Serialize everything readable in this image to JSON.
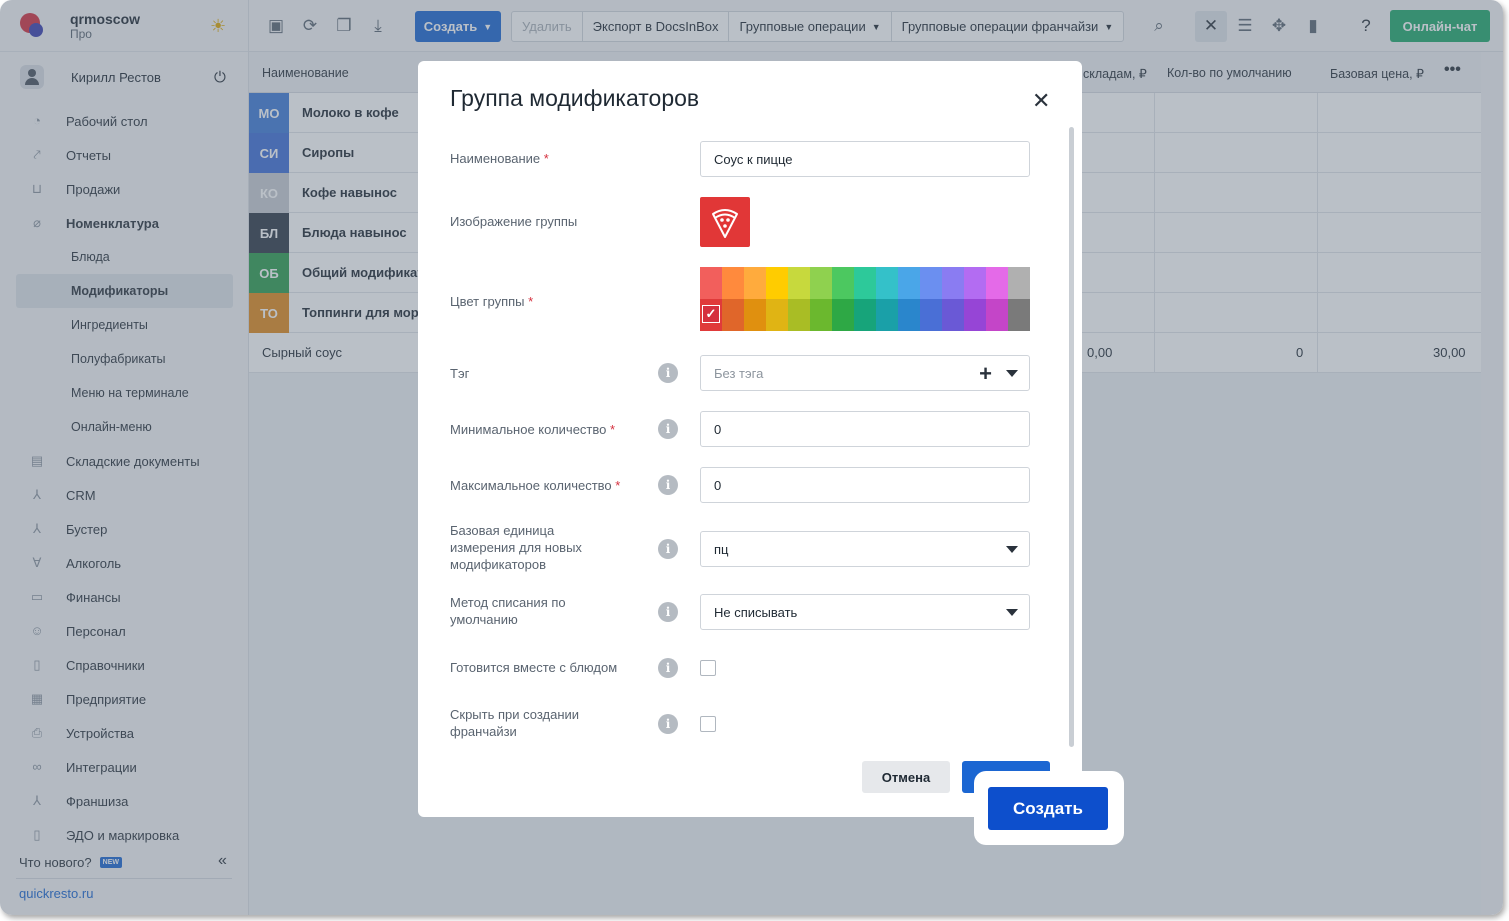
{
  "brand": {
    "name": "qrmoscow",
    "plan": "Про"
  },
  "user": {
    "name": "Кирилл Рестов"
  },
  "nav": [
    {
      "label": "Рабочий стол",
      "icon": "dashboard-icon",
      "glyph": "◔"
    },
    {
      "label": "Отчеты",
      "icon": "chart-icon",
      "glyph": "⤤"
    },
    {
      "label": "Продажи",
      "icon": "basket-icon",
      "glyph": "⊔"
    },
    {
      "label": "Номенклатура",
      "icon": "tag-icon",
      "glyph": "⌀"
    }
  ],
  "nav_sub": [
    "Блюда",
    "Модификаторы",
    "Ингредиенты",
    "Полуфабрикаты",
    "Меню на терминале",
    "Онлайн-меню"
  ],
  "nav_more": [
    {
      "label": "Складские документы",
      "icon": "warehouse-icon",
      "glyph": "▤"
    },
    {
      "label": "CRM",
      "icon": "crm-icon",
      "glyph": "⅄"
    },
    {
      "label": "Бустер",
      "icon": "booster-icon",
      "glyph": "⅄"
    },
    {
      "label": "Алкоголь",
      "icon": "glass-icon",
      "glyph": "∀"
    },
    {
      "label": "Финансы",
      "icon": "wallet-icon",
      "glyph": "▭"
    },
    {
      "label": "Персонал",
      "icon": "people-icon",
      "glyph": "☺"
    },
    {
      "label": "Справочники",
      "icon": "book-icon",
      "glyph": "▯"
    },
    {
      "label": "Предприятие",
      "icon": "building-icon",
      "glyph": "▦"
    },
    {
      "label": "Устройства",
      "icon": "printer-icon",
      "glyph": "⎙"
    },
    {
      "label": "Интеграции",
      "icon": "link-icon",
      "glyph": "∞"
    },
    {
      "label": "Франшиза",
      "icon": "franchise-icon",
      "glyph": "⅄"
    },
    {
      "label": "ЭДО и маркировка",
      "icon": "doc-icon",
      "glyph": "▯"
    }
  ],
  "whats_new": {
    "label": "Что нового?",
    "badge": "NEW"
  },
  "site": "quickresto.ru",
  "toolbar": {
    "create": "Создать",
    "delete": "Удалить",
    "export": "Экспорт в DocsInBox",
    "group_ops": "Групповые операции",
    "group_ops_fr": "Групповые операции франчайзи",
    "chat": "Онлайн-чат"
  },
  "table": {
    "headers": [
      "Наименование",
      "складам, ₽",
      "Кол-во по умолчанию",
      "Базовая цена, ₽"
    ],
    "rows": [
      {
        "abbr": "МО",
        "name": "Молоко в кофе",
        "color": "#3f7bd8"
      },
      {
        "abbr": "СИ",
        "name": "Сиропы",
        "color": "#3f6ed8"
      },
      {
        "abbr": "КО",
        "name": "Кофе навынос",
        "color": "#c8ccd2"
      },
      {
        "abbr": "БЛ",
        "name": "Блюда навынос",
        "color": "#2f3a47"
      },
      {
        "abbr": "ОБ",
        "name": "Общий модификат",
        "color": "#2e9e4e"
      },
      {
        "abbr": "ТО",
        "name": "Топпинги для моро",
        "color": "#e28a1c"
      }
    ],
    "plain_row": {
      "name": "Сырный соус",
      "v1": "0,00",
      "v2": "0",
      "v3": "30,00"
    }
  },
  "modal": {
    "title": "Группа модификаторов",
    "fields": {
      "name_label": "Наименование",
      "name_value": "Соус к пицце",
      "image_label": "Изображение группы",
      "color_label": "Цвет группы",
      "tag_label": "Тэг",
      "tag_placeholder": "Без тэга",
      "min_label": "Минимальное количество",
      "min_value": "0",
      "max_label": "Максимальное количество",
      "max_value": "0",
      "unit_label": "Базовая единица измерения для новых модификаторов",
      "unit_value": "пц",
      "method_label": "Метод списания по умолчанию",
      "method_value": "Не списывать",
      "cooked_label": "Готовится вместе с блюдом",
      "hide_label": "Скрыть при создании франчайзи"
    },
    "palette_top": [
      "#f25f5c",
      "#ff8a3d",
      "#ffab3d",
      "#ffcc00",
      "#c7d93d",
      "#8fd14f",
      "#4cc860",
      "#2dc99a",
      "#34c1c9",
      "#4aa6e8",
      "#6b8ff0",
      "#8a7cf2",
      "#b36cf2",
      "#e46ae8",
      "#b0b0b0",
      "#e2e2e2"
    ],
    "palette_bottom": [
      "#e03a3a",
      "#e0662a",
      "#e0900f",
      "#e0b414",
      "#a9bd25",
      "#6bb82e",
      "#2ea845",
      "#17a47a",
      "#1aa0a8",
      "#2a86cc",
      "#4a6fd6",
      "#6a59d6",
      "#9645d6",
      "#c445c8",
      "#7a7a7a",
      "#4a4a4a"
    ],
    "selected_color_index": 0,
    "cancel": "Отмена",
    "create": "Создать"
  }
}
